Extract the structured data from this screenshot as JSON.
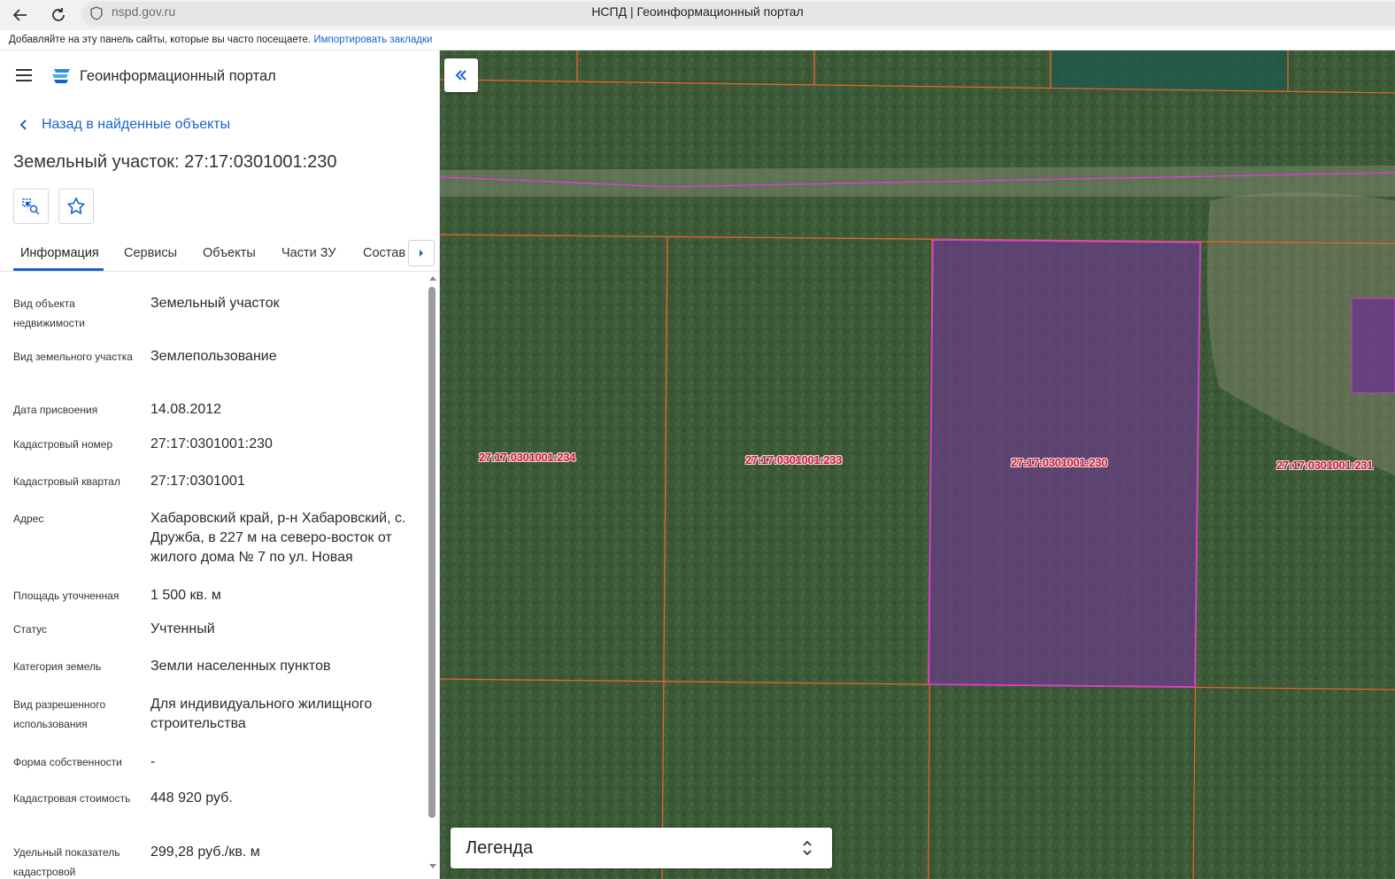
{
  "browser": {
    "url": "nspd.gov.ru",
    "title": "НСПД | Геоинформационный портал",
    "bookmarks_prompt": "Добавляйте на эту панель сайты, которые вы часто посещаете.",
    "bookmarks_link": "Импортировать закладки"
  },
  "header": {
    "portal_title": "Геоинформационный портал"
  },
  "back_link": "Назад в найденные объекты",
  "object_title": "Земельный участок: 27:17:0301001:230",
  "tabs": [
    {
      "label": "Информация"
    },
    {
      "label": "Сервисы"
    },
    {
      "label": "Объекты"
    },
    {
      "label": "Части ЗУ"
    },
    {
      "label": "Состав"
    }
  ],
  "info": [
    {
      "label": "Вид объекта недвижимости",
      "value": "Земельный участок"
    },
    {
      "label": "Вид земельного участка",
      "value": "Землепользование"
    },
    {
      "label": "Дата присвоения",
      "value": "14.08.2012"
    },
    {
      "label": "Кадастровый номер",
      "value": "27:17:0301001:230"
    },
    {
      "label": "Кадастровый квартал",
      "value": "27:17:0301001"
    },
    {
      "label": "Адрес",
      "value": "Хабаровский край, р-н Хабаровский, с. Дружба, в 227 м на северо-восток от жилого дома № 7 по ул. Новая"
    },
    {
      "label": "Площадь уточненная",
      "value": "1 500 кв. м"
    },
    {
      "label": "Статус",
      "value": "Учтенный"
    },
    {
      "label": "Категория земель",
      "value": "Земли населенных пунктов"
    },
    {
      "label": "Вид разрешенного использования",
      "value": "Для индивидуального жилищного строительства"
    },
    {
      "label": "Форма собственности",
      "value": "-"
    },
    {
      "label": "Кадастровая стоимость",
      "value": "448 920 руб."
    },
    {
      "label": "Удельный показатель кадастровой",
      "value": "299,28 руб./кв. м"
    }
  ],
  "map": {
    "parcel_labels": [
      "27:17:0301001:234",
      "27:17:0301001:233",
      "27:17:0301001:230",
      "27:17:0301001:231"
    ],
    "legend_label": "Легенда",
    "colors": {
      "boundary": "#e8642a",
      "selected_boundary": "#d63fd0",
      "selected_fill": "#6a3a86",
      "road_line": "#d63fd0"
    }
  },
  "colors": {
    "accent": "#1a62c9",
    "label_text": "#c81e3a"
  }
}
